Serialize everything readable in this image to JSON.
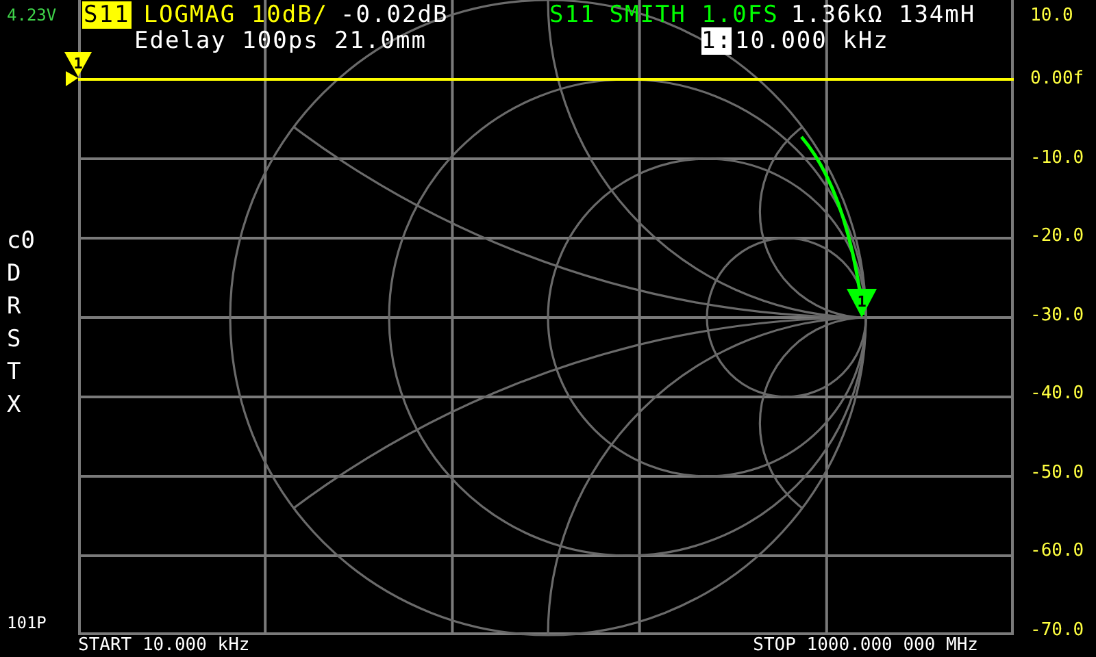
{
  "battery": "4.23V",
  "traces": [
    {
      "channel": "S11",
      "format": "LOGMAG 10dB/",
      "value": "-0.02dB",
      "color": "#ffff00",
      "selected": true,
      "marker_label": "1",
      "kind": "logmag"
    },
    {
      "channel": "S11",
      "format": "SMITH 1.0FS",
      "value": "1.36kΩ 134mH",
      "color": "#00ff00",
      "selected": false,
      "marker_label": "1",
      "kind": "smith"
    }
  ],
  "edelay": "Edelay 100ps 21.0mm",
  "marker": {
    "number": "1:",
    "frequency": "10.000 kHz"
  },
  "side_menu": [
    "c0",
    "D",
    "R",
    "S",
    "T",
    "X"
  ],
  "points": "101P",
  "scale": [
    "10.0",
    "0.00f",
    "-10.0",
    "-20.0",
    "-30.0",
    "-40.0",
    "-50.0",
    "-60.0",
    "-70.0"
  ],
  "start": "START 10.000 kHz",
  "stop": "STOP 1000.000 000 MHz"
}
